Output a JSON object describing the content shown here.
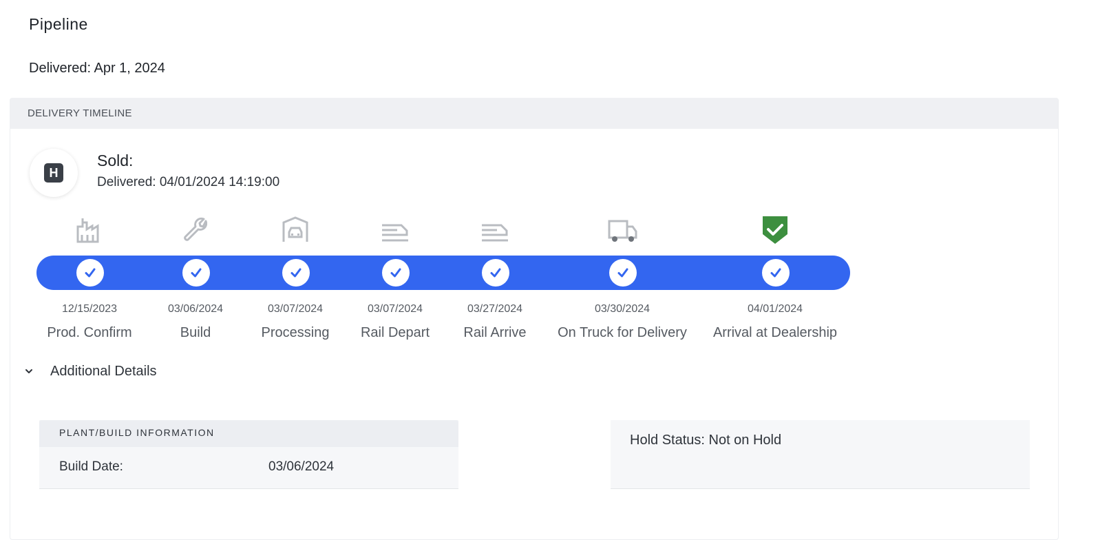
{
  "page": {
    "title": "Pipeline",
    "delivered_summary": "Delivered: Apr 1, 2024"
  },
  "timeline": {
    "header": "DELIVERY TIMELINE",
    "avatar_letter": "H",
    "sold_label": "Sold:",
    "delivered_detail": "Delivered: 04/01/2024 14:19:00",
    "accent_color": "#3366f0",
    "complete_color": "#3d8f3f",
    "stages": [
      {
        "date": "12/15/2023",
        "label": "Prod. Confirm",
        "icon": "factory-icon",
        "done": true
      },
      {
        "date": "03/06/2024",
        "label": "Build",
        "icon": "wrench-icon",
        "done": true
      },
      {
        "date": "03/07/2024",
        "label": "Processing",
        "icon": "garage-car-icon",
        "done": true
      },
      {
        "date": "03/07/2024",
        "label": "Rail Depart",
        "icon": "train-icon",
        "done": true
      },
      {
        "date": "03/27/2024",
        "label": "Rail Arrive",
        "icon": "train-icon",
        "done": true
      },
      {
        "date": "03/30/2024",
        "label": "On Truck for Delivery",
        "icon": "truck-icon",
        "done": true
      },
      {
        "date": "04/01/2024",
        "label": "Arrival at Dealership",
        "icon": "shield-check-icon",
        "done": true
      }
    ]
  },
  "additional": {
    "toggle_label": "Additional Details",
    "plant": {
      "header": "PLANT/BUILD INFORMATION",
      "build_date_label": "Build Date:",
      "build_date_value": "03/06/2024"
    },
    "hold_status": "Hold Status: Not on Hold"
  }
}
